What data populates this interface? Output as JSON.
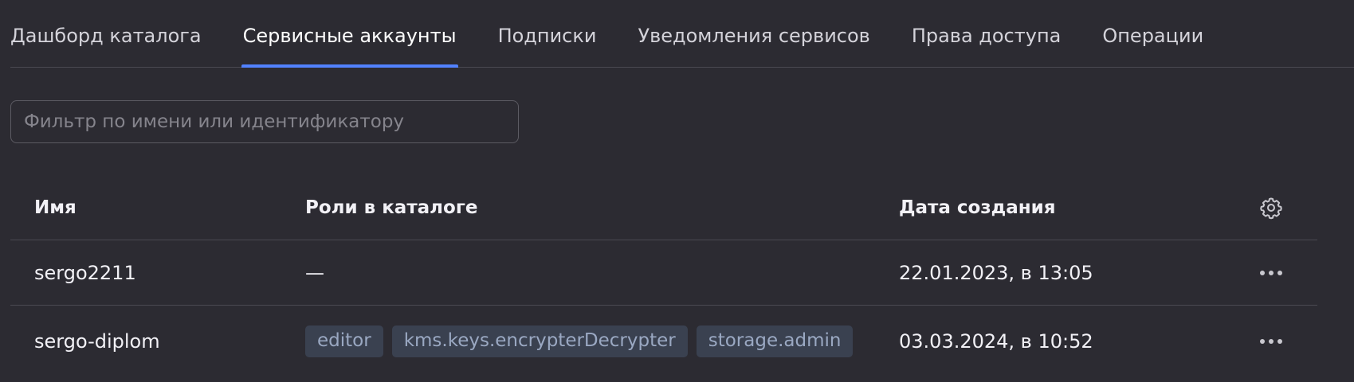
{
  "tabs": [
    {
      "label": "Дашборд каталога"
    },
    {
      "label": "Сервисные аккаунты",
      "active": true
    },
    {
      "label": "Подписки"
    },
    {
      "label": "Уведомления сервисов"
    },
    {
      "label": "Права доступа"
    },
    {
      "label": "Операции"
    }
  ],
  "filter": {
    "placeholder": "Фильтр по имени или идентификатору",
    "value": ""
  },
  "table": {
    "columns": {
      "name": "Имя",
      "roles": "Роли в каталоге",
      "created": "Дата создания",
      "settings_icon": "gear-icon"
    },
    "rows": [
      {
        "name": "sergo2211",
        "roles_empty": "—",
        "roles": [],
        "created": "22.01.2023, в 13:05",
        "actions_icon": "more-horizontal-icon"
      },
      {
        "name": "sergo-diplom",
        "roles": [
          "editor",
          "kms.keys.encrypterDecrypter",
          "storage.admin"
        ],
        "created": "03.03.2024, в 10:52",
        "actions_icon": "more-horizontal-icon"
      }
    ]
  },
  "colors": {
    "background": "#2c2b32",
    "accent": "#5282ff",
    "role_chip_bg": "#3a4150",
    "role_chip_text": "#9aa8c2"
  }
}
